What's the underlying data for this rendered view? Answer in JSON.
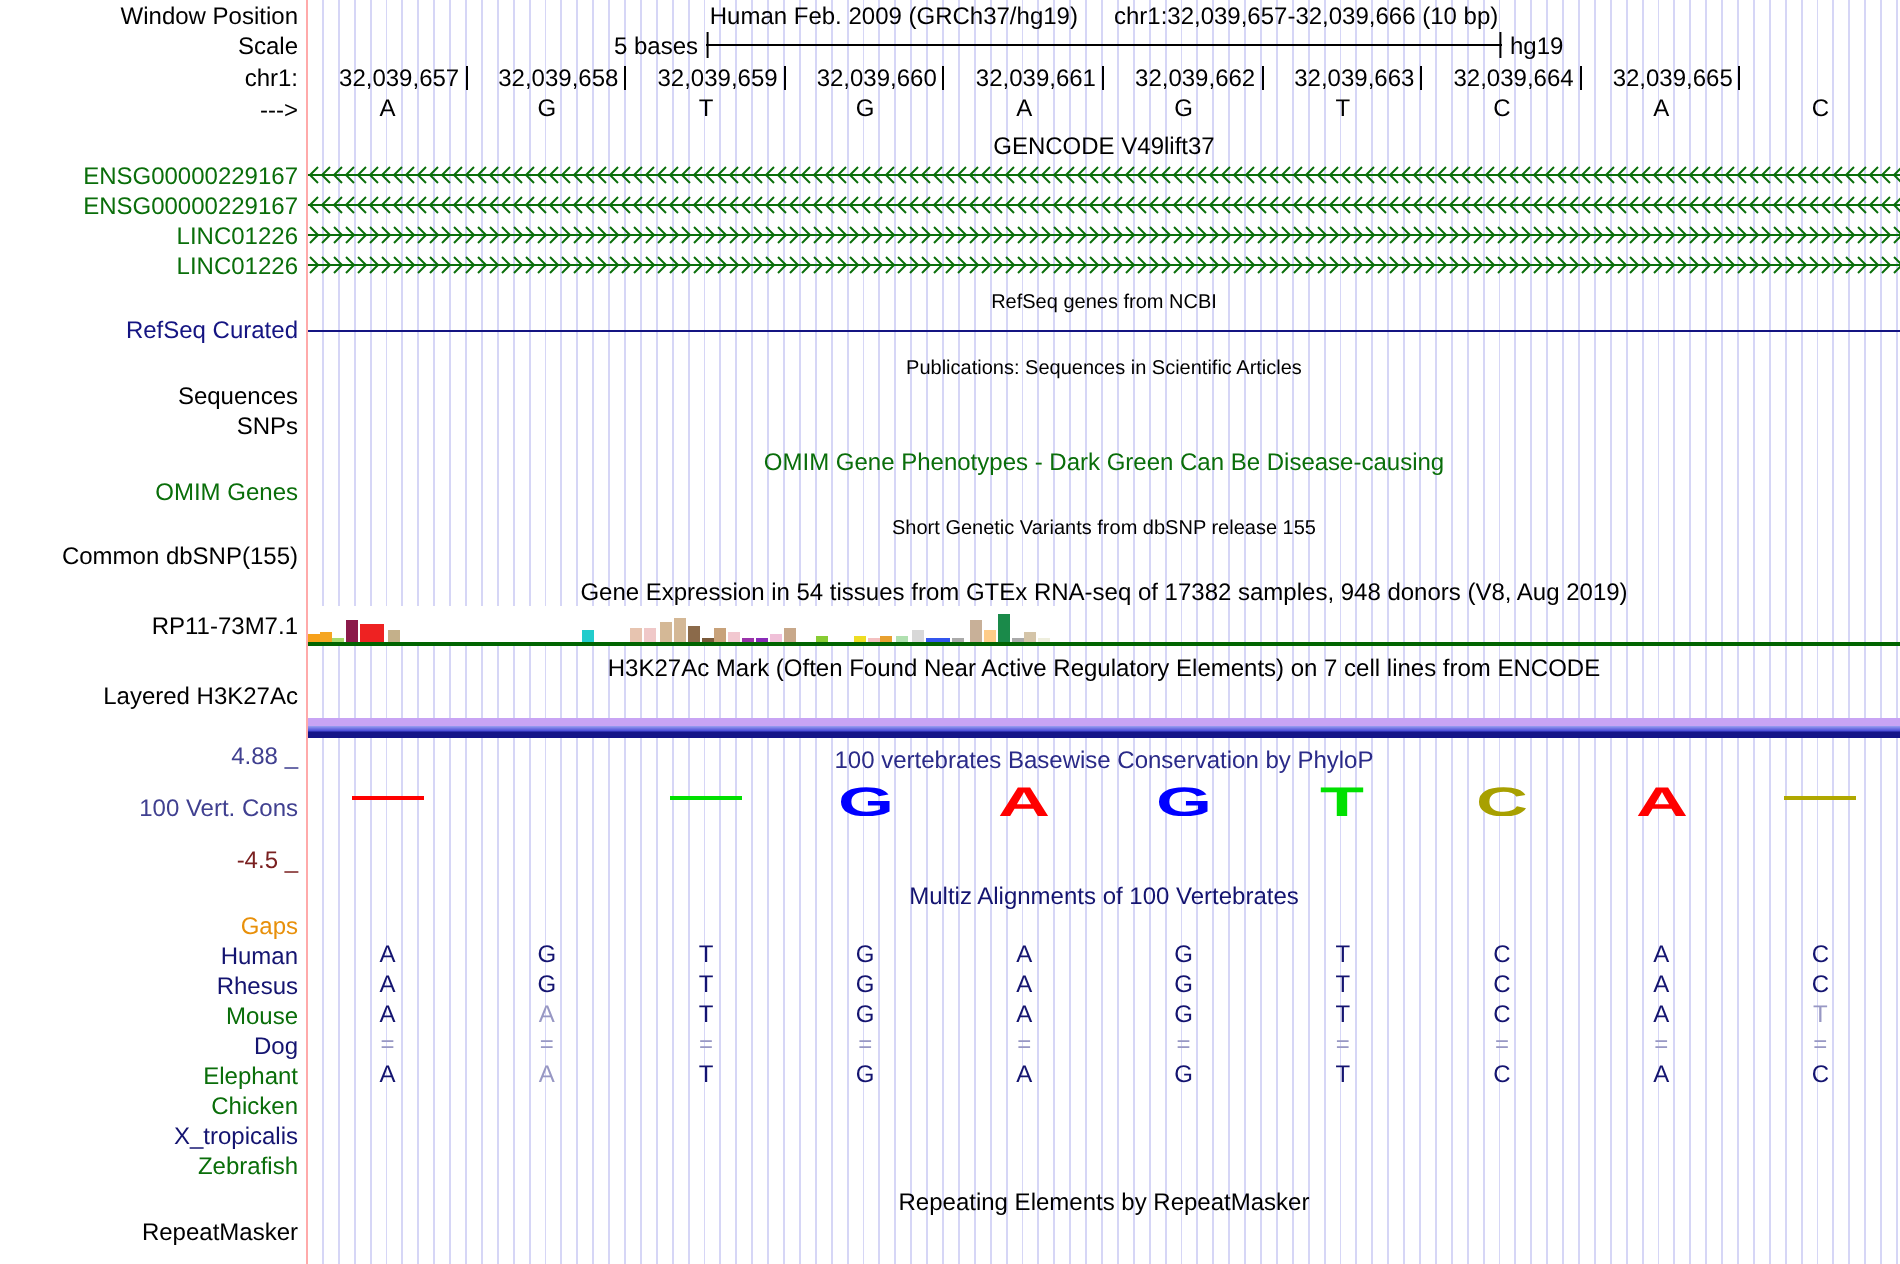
{
  "header": {
    "window_position_label": "Window Position",
    "assembly": "Human Feb. 2009 (GRCh37/hg19)",
    "region": "chr1:32,039,657-32,039,666 (10 bp)",
    "scale_label": "Scale",
    "scale_text": "5 bases",
    "scale_db": "hg19",
    "chrom_label": "chr1:",
    "positions": [
      "32,039,657",
      "32,039,658",
      "32,039,659",
      "32,039,660",
      "32,039,661",
      "32,039,662",
      "32,039,663",
      "32,039,664",
      "32,039,665"
    ],
    "strand_label": "--->",
    "bases": [
      "A",
      "G",
      "T",
      "G",
      "A",
      "G",
      "T",
      "C",
      "A",
      "C"
    ]
  },
  "tracks": [
    {
      "kind": "title",
      "text": "GENCODE V49lift37",
      "color": "#000000"
    },
    {
      "kind": "gene",
      "label": "ENSG00000229167",
      "color": "#0a6e0a",
      "reverse": true
    },
    {
      "kind": "gene",
      "label": "ENSG00000229167",
      "color": "#0a6e0a",
      "reverse": true
    },
    {
      "kind": "gene",
      "label": "LINC01226",
      "color": "#0a6e0a",
      "reverse": false
    },
    {
      "kind": "gene",
      "label": "LINC01226",
      "color": "#0a6e0a",
      "reverse": false
    },
    {
      "kind": "note",
      "text": "RefSeq genes from NCBI",
      "color": "#000000"
    },
    {
      "kind": "line",
      "label": "RefSeq Curated",
      "color": "#141482"
    },
    {
      "kind": "note",
      "text": "Publications: Sequences in Scientific Articles",
      "color": "#000000"
    },
    {
      "kind": "label",
      "label": "Sequences",
      "color": "#000000"
    },
    {
      "kind": "label",
      "label": "SNPs",
      "color": "#000000"
    },
    {
      "kind": "title",
      "text": "OMIM Gene Phenotypes - Dark Green Can Be Disease-causing",
      "color": "#0a6e0a"
    },
    {
      "kind": "label",
      "label": "OMIM Genes",
      "color": "#0a6e0a"
    },
    {
      "kind": "note",
      "text": "Short Genetic Variants from dbSNP release 155",
      "color": "#000000"
    },
    {
      "kind": "label",
      "label": "Common dbSNP(155)",
      "color": "#000000"
    },
    {
      "kind": "title",
      "text": "Gene Expression in 54 tissues from GTEx RNA-seq of 17382 samples, 948 donors (V8, Aug 2019)",
      "color": "#000000"
    },
    {
      "kind": "expression",
      "label": "RP11-73M7.1"
    },
    {
      "kind": "title",
      "text": "H3K27Ac Mark (Often Found Near Active Regulatory Elements) on 7 cell lines from ENCODE",
      "color": "#000000"
    },
    {
      "kind": "layered",
      "label": "Layered H3K27Ac"
    },
    {
      "kind": "conservation",
      "label": "100 Vert. Cons",
      "ymax": "4.88 _",
      "ymin": "-4.5 _",
      "title": "100 vertebrates Basewise Conservation by PhyloP",
      "letters": [
        {
          "kind": "mark",
          "color": "#ff0000"
        },
        {
          "kind": "blank"
        },
        {
          "kind": "mark",
          "color": "#00e000"
        },
        {
          "kind": "letter",
          "base": "G",
          "color": "#0000ff"
        },
        {
          "kind": "letter",
          "base": "A",
          "color": "#ff0000"
        },
        {
          "kind": "letter",
          "base": "G",
          "color": "#0000ff"
        },
        {
          "kind": "letter",
          "base": "T",
          "color": "#00e000"
        },
        {
          "kind": "letter",
          "base": "C",
          "color": "#a8a000"
        },
        {
          "kind": "letter",
          "base": "A",
          "color": "#ff0000"
        },
        {
          "kind": "mark",
          "color": "#b0a800"
        }
      ]
    },
    {
      "kind": "title",
      "text": "Multiz Alignments of 100 Vertebrates",
      "color": "#141470"
    },
    {
      "kind": "label",
      "label": "Gaps",
      "color": "#e8900a"
    },
    {
      "kind": "species",
      "label": "Human",
      "color": "#141470",
      "bases": [
        {
          "text": "A",
          "faint": false
        },
        {
          "text": "G",
          "faint": false
        },
        {
          "text": "T",
          "faint": false
        },
        {
          "text": "G",
          "faint": false
        },
        {
          "text": "A",
          "faint": false
        },
        {
          "text": "G",
          "faint": false
        },
        {
          "text": "T",
          "faint": false
        },
        {
          "text": "C",
          "faint": false
        },
        {
          "text": "A",
          "faint": false
        },
        {
          "text": "C",
          "faint": false
        }
      ]
    },
    {
      "kind": "species",
      "label": "Rhesus",
      "color": "#141470",
      "bases": [
        {
          "text": "A",
          "faint": false
        },
        {
          "text": "G",
          "faint": false
        },
        {
          "text": "T",
          "faint": false
        },
        {
          "text": "G",
          "faint": false
        },
        {
          "text": "A",
          "faint": false
        },
        {
          "text": "G",
          "faint": false
        },
        {
          "text": "T",
          "faint": false
        },
        {
          "text": "C",
          "faint": false
        },
        {
          "text": "A",
          "faint": false
        },
        {
          "text": "C",
          "faint": false
        }
      ]
    },
    {
      "kind": "species",
      "label": "Mouse",
      "color": "#0a6e0a",
      "bases": [
        {
          "text": "A",
          "faint": false
        },
        {
          "text": "A",
          "faint": true
        },
        {
          "text": "T",
          "faint": false
        },
        {
          "text": "G",
          "faint": false
        },
        {
          "text": "A",
          "faint": false
        },
        {
          "text": "G",
          "faint": false
        },
        {
          "text": "T",
          "faint": false
        },
        {
          "text": "C",
          "faint": false
        },
        {
          "text": "A",
          "faint": false
        },
        {
          "text": "T",
          "faint": true
        }
      ]
    },
    {
      "kind": "species",
      "label": "Dog",
      "color": "#141470",
      "bases": [
        {
          "text": "=",
          "faint": true
        },
        {
          "text": "=",
          "faint": true
        },
        {
          "text": "=",
          "faint": true
        },
        {
          "text": "=",
          "faint": true
        },
        {
          "text": "=",
          "faint": true
        },
        {
          "text": "=",
          "faint": true
        },
        {
          "text": "=",
          "faint": true
        },
        {
          "text": "=",
          "faint": true
        },
        {
          "text": "=",
          "faint": true
        },
        {
          "text": "=",
          "faint": true
        }
      ]
    },
    {
      "kind": "species",
      "label": "Elephant",
      "color": "#0a6e0a",
      "bases": [
        {
          "text": "A",
          "faint": false
        },
        {
          "text": "A",
          "faint": true
        },
        {
          "text": "T",
          "faint": false
        },
        {
          "text": "G",
          "faint": false
        },
        {
          "text": "A",
          "faint": false
        },
        {
          "text": "G",
          "faint": false
        },
        {
          "text": "T",
          "faint": false
        },
        {
          "text": "C",
          "faint": false
        },
        {
          "text": "A",
          "faint": false
        },
        {
          "text": "C",
          "faint": false
        }
      ]
    },
    {
      "kind": "species",
      "label": "Chicken",
      "color": "#0a6e0a"
    },
    {
      "kind": "species",
      "label": "X_tropicalis",
      "color": "#141470"
    },
    {
      "kind": "species",
      "label": "Zebrafish",
      "color": "#0a6e0a"
    },
    {
      "kind": "title",
      "text": "Repeating Elements by RepeatMasker",
      "color": "#000000"
    },
    {
      "kind": "label",
      "label": "RepeatMasker",
      "color": "#000000"
    }
  ]
}
